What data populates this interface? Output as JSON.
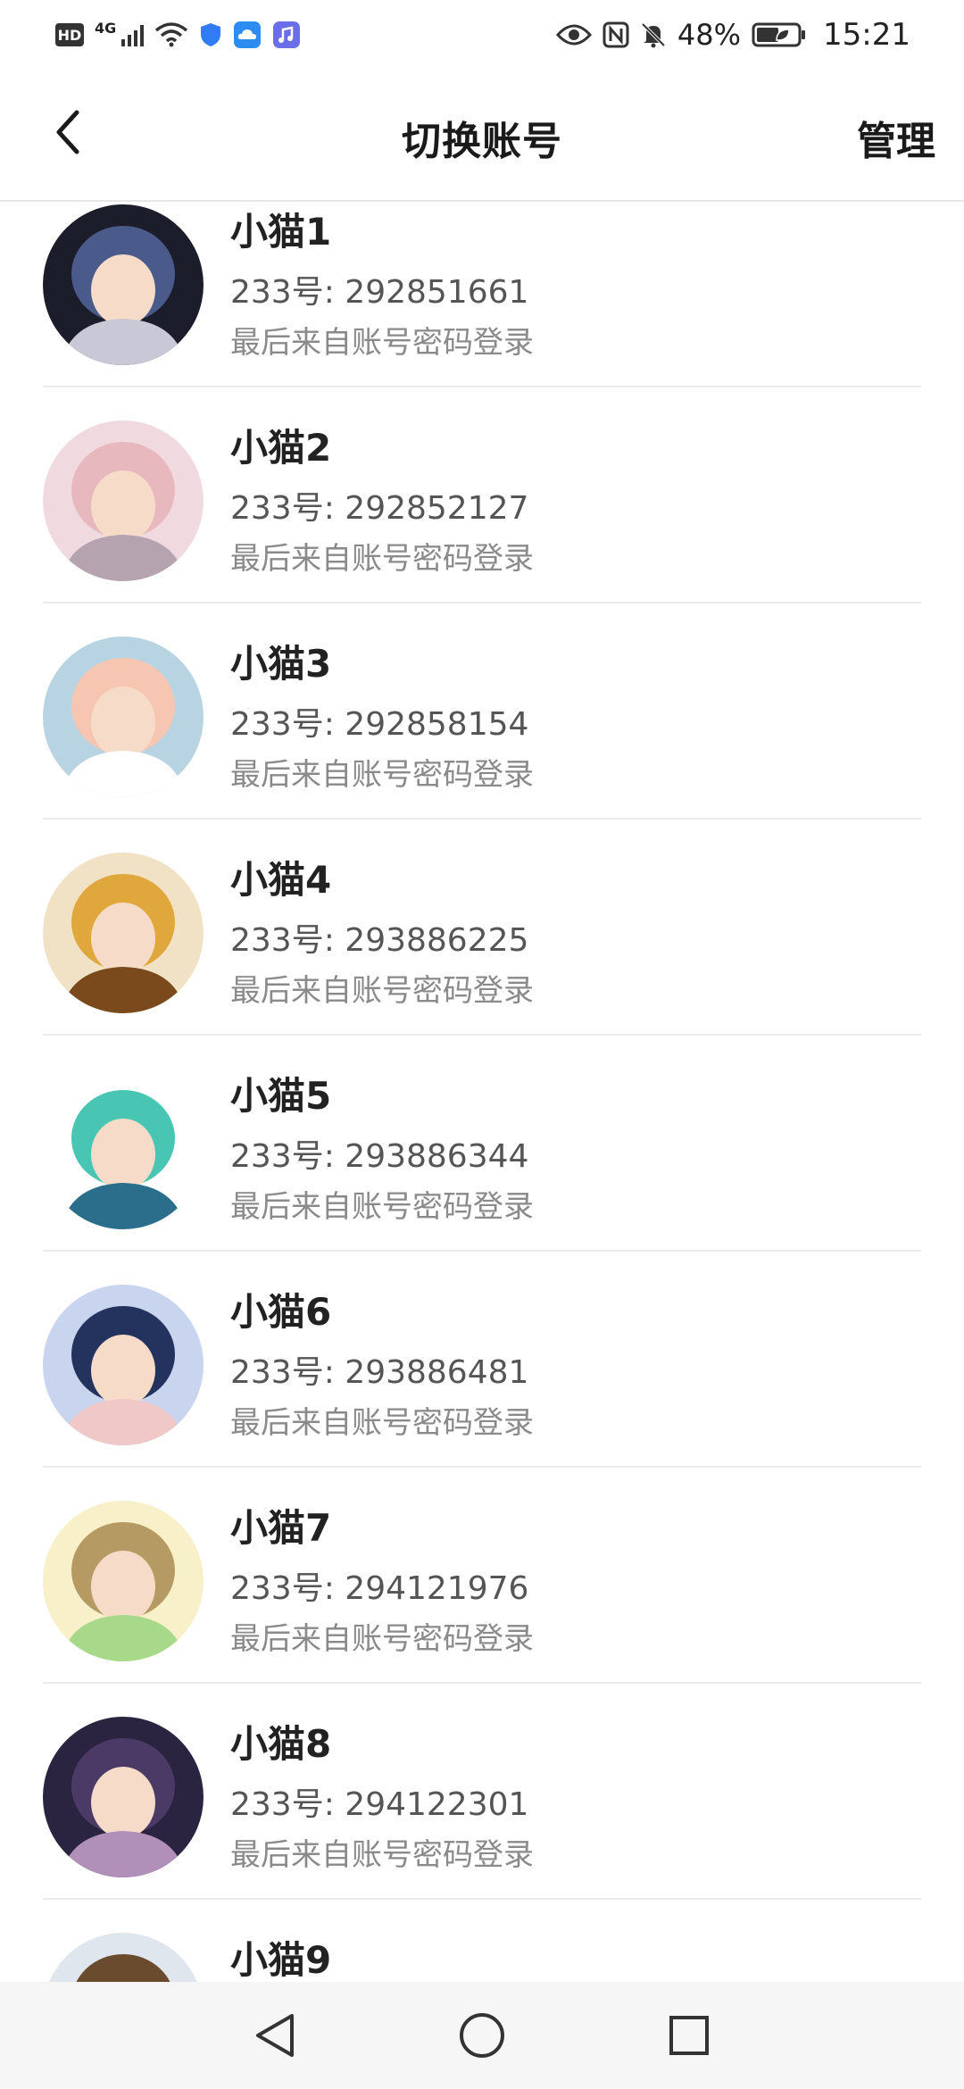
{
  "status_bar": {
    "hd": "HD",
    "network": "4G",
    "battery": "48%",
    "time": "15:21",
    "icons": [
      "wifi-icon",
      "shield-icon",
      "cloud-icon",
      "music-icon",
      "eye-icon",
      "nfc-icon",
      "bell-off-icon",
      "battery-icon"
    ]
  },
  "header": {
    "title": "切换账号",
    "manage_label": "管理",
    "back_icon": "back-arrow-icon"
  },
  "accounts": [
    {
      "name": "小猫1",
      "id_line": "233号: 292851661",
      "source": "最后来自账号密码登录",
      "avatar_colors": [
        "#1b1d2a",
        "#4a5a8a",
        "#c8c8d6"
      ]
    },
    {
      "name": "小猫2",
      "id_line": "233号: 292852127",
      "source": "最后来自账号密码登录",
      "avatar_colors": [
        "#f1dadf",
        "#e7b9bf",
        "#b6a3b0"
      ]
    },
    {
      "name": "小猫3",
      "id_line": "233号: 292858154",
      "source": "最后来自账号密码登录",
      "avatar_colors": [
        "#b8d4e2",
        "#f6c6b2",
        "#ffffff"
      ]
    },
    {
      "name": "小猫4",
      "id_line": "233号: 293886225",
      "source": "最后来自账号密码登录",
      "avatar_colors": [
        "#f1e2c6",
        "#e0a83c",
        "#7a4a1d"
      ]
    },
    {
      "name": "小猫5",
      "id_line": "233号: 293886344",
      "source": "最后来自账号密码登录",
      "avatar_colors": [
        "#ffffff",
        "#48c6b3",
        "#2a6e8c"
      ]
    },
    {
      "name": "小猫6",
      "id_line": "233号: 293886481",
      "source": "最后来自账号密码登录",
      "avatar_colors": [
        "#c9d4ee",
        "#23335e",
        "#f0c8c8"
      ]
    },
    {
      "name": "小猫7",
      "id_line": "233号: 294121976",
      "source": "最后来自账号密码登录",
      "avatar_colors": [
        "#f7f0c8",
        "#b59b63",
        "#a8d98a"
      ]
    },
    {
      "name": "小猫8",
      "id_line": "233号: 294122301",
      "source": "最后来自账号密码登录",
      "avatar_colors": [
        "#2b2440",
        "#4b3a66",
        "#b090b8"
      ]
    },
    {
      "name": "小猫9",
      "id_line": "",
      "source": "",
      "avatar_colors": [
        "#dfe6ee",
        "#6b4b2e",
        "#f0c9a0"
      ]
    }
  ],
  "nav": {
    "back": "nav-back-icon",
    "home": "nav-home-icon",
    "recents": "nav-recents-icon"
  }
}
